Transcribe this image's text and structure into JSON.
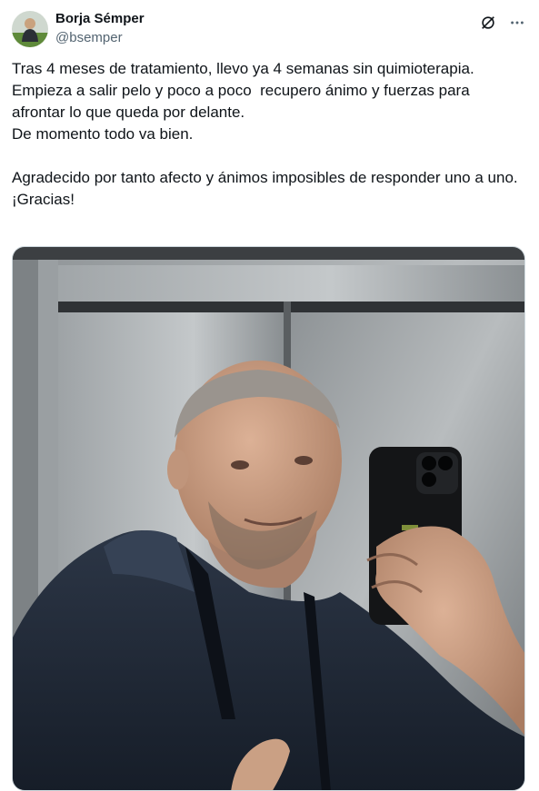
{
  "author": {
    "display_name": "Borja Sémper",
    "handle": "@bsemper"
  },
  "tweet": {
    "text": "Tras 4 meses de tratamiento, llevo ya 4 semanas sin quimioterapia.\nEmpieza a salir pelo y poco a poco  recupero ánimo y fuerzas para afrontar lo que queda por delante.\nDe momento todo va bien.\n\nAgradecido por tanto afecto y ánimos imposibles de responder uno a uno.\n¡Gracias!"
  },
  "icons": {
    "grok": "grok-icon",
    "more": "more-options-icon"
  },
  "colors": {
    "text": "#0f1419",
    "secondary": "#536471"
  }
}
